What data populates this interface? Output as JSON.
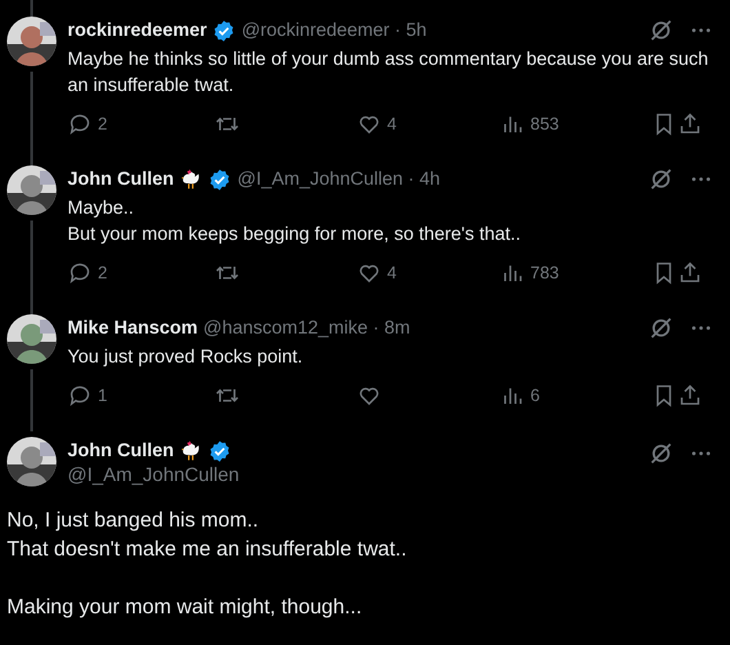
{
  "tweets": [
    {
      "kind": "reply",
      "name": "rockinredeemer",
      "chicken": false,
      "verified": true,
      "meta": "@rockinredeemer · 5h",
      "text": "Maybe he thinks so little of your dumb ass commentary because you are such an insufferable twat.",
      "stats": {
        "replies": "2",
        "likes": "4",
        "views": "853"
      }
    },
    {
      "kind": "reply",
      "name": "John Cullen",
      "chicken": true,
      "verified": true,
      "meta": "@I_Am_JohnCullen · 4h",
      "text": "Maybe..\nBut your mom keeps begging for more, so there's that..",
      "stats": {
        "replies": "2",
        "likes": "4",
        "views": "783"
      }
    },
    {
      "kind": "reply",
      "name": "Mike Hanscom",
      "chicken": false,
      "verified": false,
      "meta": "@hanscom12_mike · 8m",
      "text": "You just proved Rocks point.",
      "stats": {
        "replies": "1",
        "views": "6"
      }
    },
    {
      "kind": "focused",
      "name": "John Cullen",
      "chicken": true,
      "verified": true,
      "meta": "@I_Am_JohnCullen",
      "text": "No, I just banged his mom..\nThat doesn't make me an insufferable twat..\n\nMaking your mom wait might, though..."
    }
  ]
}
